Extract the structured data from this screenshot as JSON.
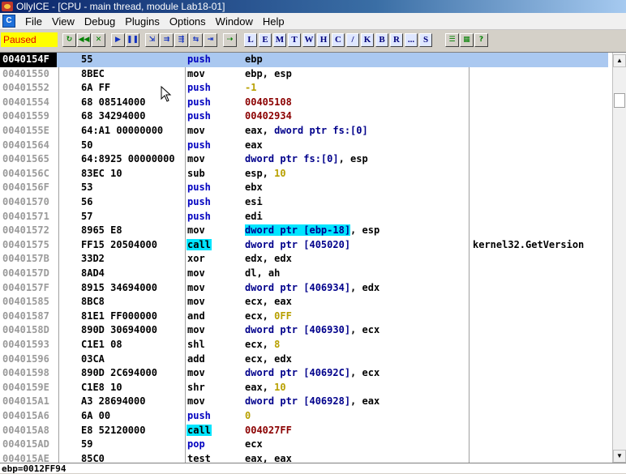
{
  "window": {
    "title": "OllyICE - [CPU - main thread, module Lab18-01]"
  },
  "menu": [
    "File",
    "View",
    "Debug",
    "Plugins",
    "Options",
    "Window",
    "Help"
  ],
  "status": {
    "text": "Paused",
    "bg": "#ffff00",
    "fg": "#e00000"
  },
  "toolbar": {
    "letters": [
      "L",
      "E",
      "M",
      "T",
      "W",
      "H",
      "C",
      "/",
      "K",
      "B",
      "R",
      "...",
      "S"
    ]
  },
  "disasm": [
    {
      "addr": "0040154F",
      "hex": "55",
      "mnem": "push",
      "ops": [
        [
          "reg",
          "ebp"
        ]
      ],
      "cmt": ""
    },
    {
      "addr": "00401550",
      "hex": "8BEC",
      "mnem": "mov",
      "ops": [
        [
          "reg",
          "ebp, esp"
        ]
      ],
      "cmt": ""
    },
    {
      "addr": "00401552",
      "hex": "6A FF",
      "mnem": "push",
      "ops": [
        [
          "num",
          "-1"
        ]
      ],
      "cmt": ""
    },
    {
      "addr": "00401554",
      "hex": "68 08514000",
      "mnem": "push",
      "ops": [
        [
          "addr",
          "00405108"
        ]
      ],
      "cmt": ""
    },
    {
      "addr": "00401559",
      "hex": "68 34294000",
      "mnem": "push",
      "ops": [
        [
          "addr",
          "00402934"
        ]
      ],
      "cmt": ""
    },
    {
      "addr": "0040155E",
      "hex": "64:A1 00000000",
      "mnem": "mov",
      "ops": [
        [
          "reg",
          "eax, "
        ],
        [
          "mem",
          "dword ptr fs:[0]"
        ]
      ],
      "cmt": ""
    },
    {
      "addr": "00401564",
      "hex": "50",
      "mnem": "push",
      "ops": [
        [
          "reg",
          "eax"
        ]
      ],
      "cmt": ""
    },
    {
      "addr": "00401565",
      "hex": "64:8925 00000000",
      "mnem": "mov",
      "ops": [
        [
          "mem",
          "dword ptr fs:[0]"
        ],
        [
          "reg",
          ", esp"
        ]
      ],
      "cmt": ""
    },
    {
      "addr": "0040156C",
      "hex": "83EC 10",
      "mnem": "sub",
      "ops": [
        [
          "reg",
          "esp, "
        ],
        [
          "num",
          "10"
        ]
      ],
      "cmt": ""
    },
    {
      "addr": "0040156F",
      "hex": "53",
      "mnem": "push",
      "ops": [
        [
          "reg",
          "ebx"
        ]
      ],
      "cmt": ""
    },
    {
      "addr": "00401570",
      "hex": "56",
      "mnem": "push",
      "ops": [
        [
          "reg",
          "esi"
        ]
      ],
      "cmt": ""
    },
    {
      "addr": "00401571",
      "hex": "57",
      "mnem": "push",
      "ops": [
        [
          "reg",
          "edi"
        ]
      ],
      "cmt": ""
    },
    {
      "addr": "00401572",
      "hex": "8965 E8",
      "mnem": "mov",
      "ops": [
        [
          "memhl",
          "dword ptr [ebp-18]"
        ],
        [
          "reg",
          ", esp"
        ]
      ],
      "cmt": ""
    },
    {
      "addr": "00401575",
      "hex": "FF15 20504000",
      "mnem": "call",
      "ops": [
        [
          "mem",
          "dword ptr [405020]"
        ]
      ],
      "cmt": "kernel32.GetVersion"
    },
    {
      "addr": "0040157B",
      "hex": "33D2",
      "mnem": "xor",
      "ops": [
        [
          "reg",
          "edx, edx"
        ]
      ],
      "cmt": ""
    },
    {
      "addr": "0040157D",
      "hex": "8AD4",
      "mnem": "mov",
      "ops": [
        [
          "reg",
          "dl, ah"
        ]
      ],
      "cmt": ""
    },
    {
      "addr": "0040157F",
      "hex": "8915 34694000",
      "mnem": "mov",
      "ops": [
        [
          "mem",
          "dword ptr [406934]"
        ],
        [
          "reg",
          ", edx"
        ]
      ],
      "cmt": ""
    },
    {
      "addr": "00401585",
      "hex": "8BC8",
      "mnem": "mov",
      "ops": [
        [
          "reg",
          "ecx, eax"
        ]
      ],
      "cmt": ""
    },
    {
      "addr": "00401587",
      "hex": "81E1 FF000000",
      "mnem": "and",
      "ops": [
        [
          "reg",
          "ecx, "
        ],
        [
          "num",
          "0FF"
        ]
      ],
      "cmt": ""
    },
    {
      "addr": "0040158D",
      "hex": "890D 30694000",
      "mnem": "mov",
      "ops": [
        [
          "mem",
          "dword ptr [406930]"
        ],
        [
          "reg",
          ", ecx"
        ]
      ],
      "cmt": ""
    },
    {
      "addr": "00401593",
      "hex": "C1E1 08",
      "mnem": "shl",
      "ops": [
        [
          "reg",
          "ecx, "
        ],
        [
          "num",
          "8"
        ]
      ],
      "cmt": ""
    },
    {
      "addr": "00401596",
      "hex": "03CA",
      "mnem": "add",
      "ops": [
        [
          "reg",
          "ecx, edx"
        ]
      ],
      "cmt": ""
    },
    {
      "addr": "00401598",
      "hex": "890D 2C694000",
      "mnem": "mov",
      "ops": [
        [
          "mem",
          "dword ptr [40692C]"
        ],
        [
          "reg",
          ", ecx"
        ]
      ],
      "cmt": ""
    },
    {
      "addr": "0040159E",
      "hex": "C1E8 10",
      "mnem": "shr",
      "ops": [
        [
          "reg",
          "eax, "
        ],
        [
          "num",
          "10"
        ]
      ],
      "cmt": ""
    },
    {
      "addr": "004015A1",
      "hex": "A3 28694000",
      "mnem": "mov",
      "ops": [
        [
          "mem",
          "dword ptr [406928]"
        ],
        [
          "reg",
          ", eax"
        ]
      ],
      "cmt": ""
    },
    {
      "addr": "004015A6",
      "hex": "6A 00",
      "mnem": "push",
      "ops": [
        [
          "num",
          "0"
        ]
      ],
      "cmt": ""
    },
    {
      "addr": "004015A8",
      "hex": "E8 52120000",
      "mnem": "call",
      "ops": [
        [
          "addr",
          "004027FF"
        ]
      ],
      "cmt": ""
    },
    {
      "addr": "004015AD",
      "hex": "59",
      "mnem": "pop",
      "ops": [
        [
          "reg",
          "ecx"
        ]
      ],
      "cmt": ""
    },
    {
      "addr": "004015AE",
      "hex": "85C0",
      "mnem": "test",
      "ops": [
        [
          "reg",
          "eax, eax"
        ]
      ],
      "cmt": ""
    }
  ],
  "info": "ebp=0012FF94"
}
